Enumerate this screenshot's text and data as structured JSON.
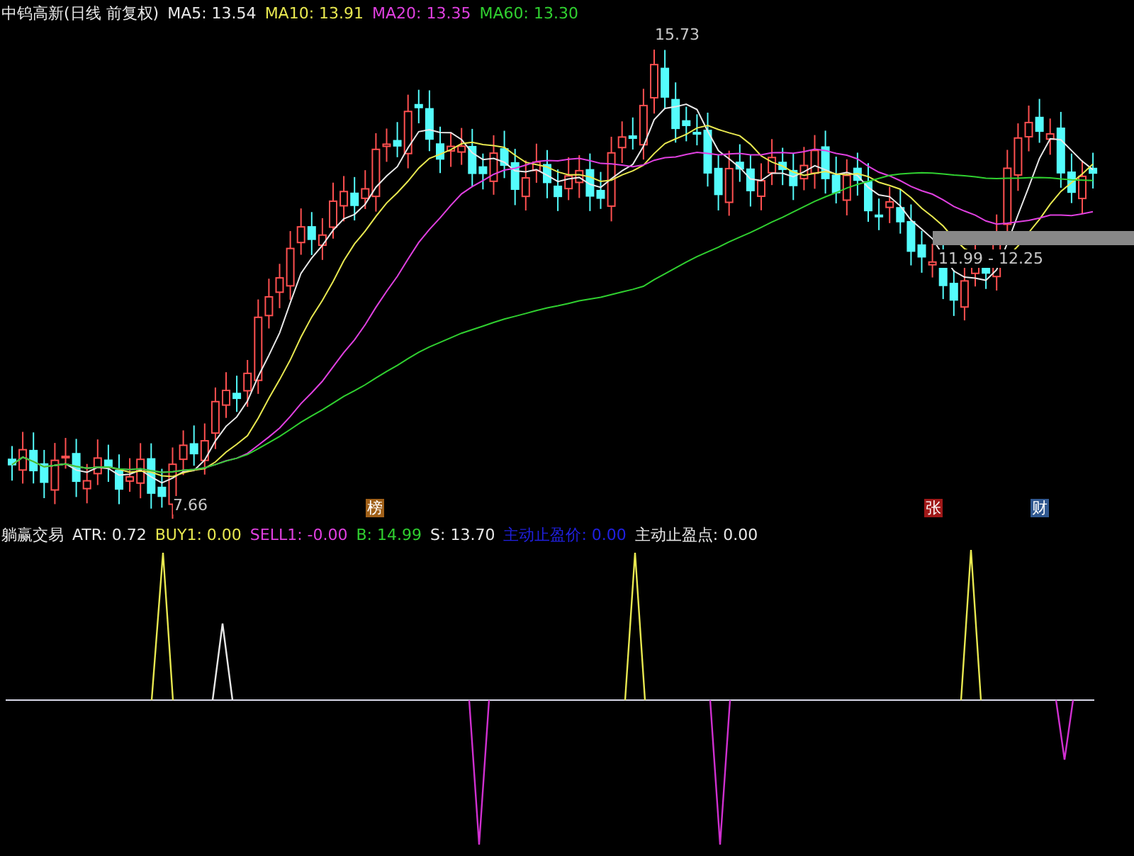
{
  "header": {
    "title": "中钨高新(日线 前复权)",
    "indicators": [
      {
        "label": "MA5: 13.54",
        "color": "#e8e8e8"
      },
      {
        "label": "MA10: 13.91",
        "color": "#e8e850"
      },
      {
        "label": "MA20: 13.35",
        "color": "#e040e0"
      },
      {
        "label": "MA60: 13.30",
        "color": "#30d030"
      }
    ]
  },
  "price_chart": {
    "high_label": "15.73",
    "low_label": "7.66",
    "range_label": "11.99 - 12.25",
    "event_tags": [
      {
        "text": "榜",
        "color": "#a06018"
      },
      {
        "text": "张",
        "color": "#a01818"
      },
      {
        "text": "财",
        "color": "#305890"
      }
    ]
  },
  "indicator_panel": {
    "title": "躺赢交易",
    "values": [
      {
        "label": "ATR: 0.72",
        "color": "#e8e8e8"
      },
      {
        "label": "BUY1: 0.00",
        "color": "#e8e850"
      },
      {
        "label": "SELL1: -0.00",
        "color": "#e040e0"
      },
      {
        "label": "B: 14.99",
        "color": "#30d030"
      },
      {
        "label": "S: 13.70",
        "color": "#e8e8e8"
      },
      {
        "label": "主动止盈价: 0.00",
        "color": "#2020e0"
      },
      {
        "label": "主动止盈点: 0.00",
        "color": "#e8e8e8"
      }
    ]
  }
}
